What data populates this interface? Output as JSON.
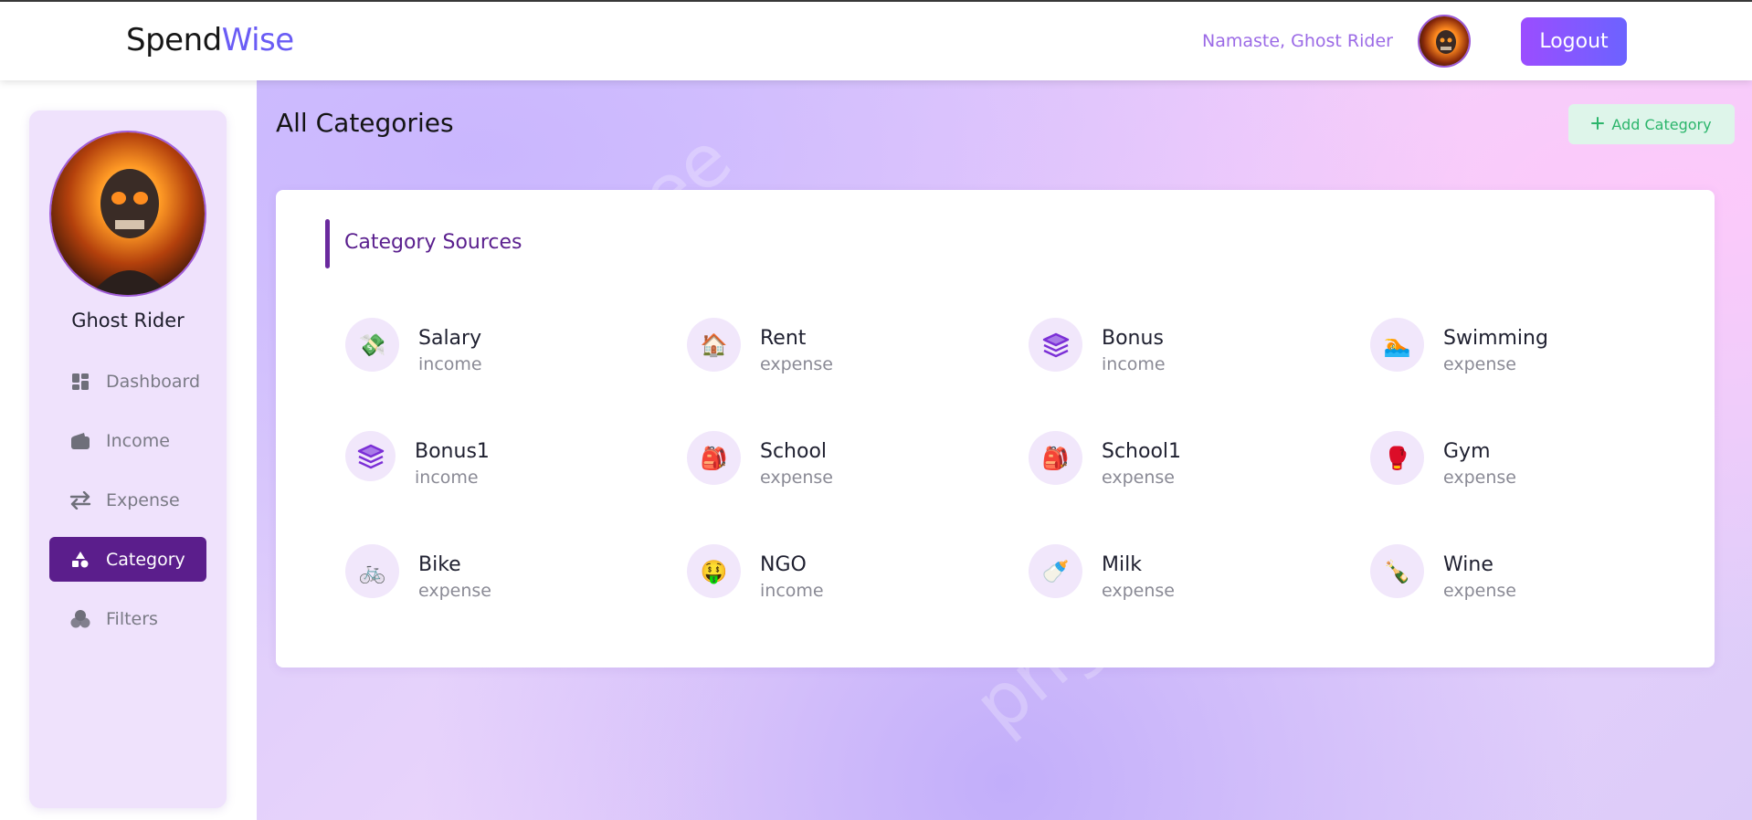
{
  "header": {
    "brand_part1": "Spend",
    "brand_part2": "Wise",
    "greeting": "Namaste, Ghost Rider",
    "logout_label": "Logout"
  },
  "sidebar": {
    "user_name": "Ghost Rider",
    "items": [
      {
        "label": "Dashboard",
        "icon": "dashboard-icon"
      },
      {
        "label": "Income",
        "icon": "wallet-icon"
      },
      {
        "label": "Expense",
        "icon": "swap-arrows-icon"
      },
      {
        "label": "Category",
        "icon": "shapes-icon",
        "active": true
      },
      {
        "label": "Filters",
        "icon": "filters-icon"
      }
    ]
  },
  "main": {
    "title": "All Categories",
    "add_button_label": "Add Category",
    "card_title": "Category Sources",
    "categories": [
      {
        "name": "Salary",
        "type": "income",
        "icon": "💸"
      },
      {
        "name": "Rent",
        "type": "expense",
        "icon": "🏠"
      },
      {
        "name": "Bonus",
        "type": "income",
        "icon": "stack-icon"
      },
      {
        "name": "Swimming",
        "type": "expense",
        "icon": "🏊"
      },
      {
        "name": "Bonus1",
        "type": "income",
        "icon": "stack-icon"
      },
      {
        "name": "School",
        "type": "expense",
        "icon": "🎒"
      },
      {
        "name": "School1",
        "type": "expense",
        "icon": "🎒"
      },
      {
        "name": "Gym",
        "type": "expense",
        "icon": "🥊"
      },
      {
        "name": "Bike",
        "type": "expense",
        "icon": "🚲"
      },
      {
        "name": "NGO",
        "type": "income",
        "icon": "🤑"
      },
      {
        "name": "Milk",
        "type": "expense",
        "icon": "🍼"
      },
      {
        "name": "Wine",
        "type": "expense",
        "icon": "🍾"
      }
    ]
  },
  "colors": {
    "accent": "#6a5cf5",
    "active_nav": "#5b1e8c",
    "card_title": "#5a1f8e",
    "add_button_bg": "#def5ea",
    "add_button_text": "#2bb56b"
  }
}
